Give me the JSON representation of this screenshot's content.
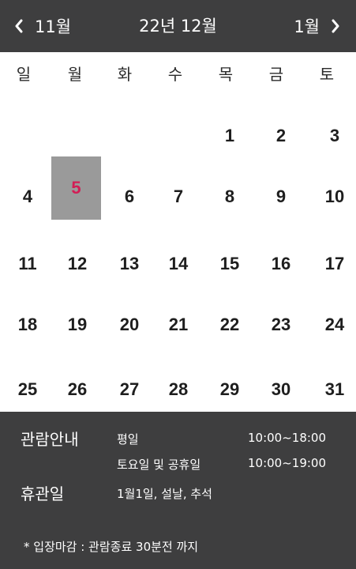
{
  "header": {
    "prev_label": "11월",
    "title": "22년 12월",
    "next_label": "1월"
  },
  "weekdays": [
    "일",
    "월",
    "화",
    "수",
    "목",
    "금",
    "토"
  ],
  "calendar": {
    "selected_day": "5",
    "weeks": [
      [
        "",
        "",
        "",
        "",
        "1",
        "2",
        "3"
      ],
      [
        "4",
        "5",
        "6",
        "7",
        "8",
        "9",
        "10"
      ],
      [
        "11",
        "12",
        "13",
        "14",
        "15",
        "16",
        "17"
      ],
      [
        "18",
        "19",
        "20",
        "21",
        "22",
        "23",
        "24"
      ],
      [
        "25",
        "26",
        "27",
        "28",
        "29",
        "30",
        "31"
      ]
    ]
  },
  "info": {
    "hours_heading": "관람안내",
    "weekday_label": "평일",
    "weekday_hours": "10:00~18:00",
    "weekend_label": "토요일 및 공휴일",
    "weekend_hours": "10:00~19:00",
    "closed_heading": "휴관일",
    "closed_days": "1월1일, 설날, 추석",
    "note": "* 입장마감 : 관람종료 30분전 까지"
  },
  "colors": {
    "bar_background": "#3e3e3f",
    "selected_background": "#9a9a9a",
    "selected_text": "#d31d55"
  }
}
